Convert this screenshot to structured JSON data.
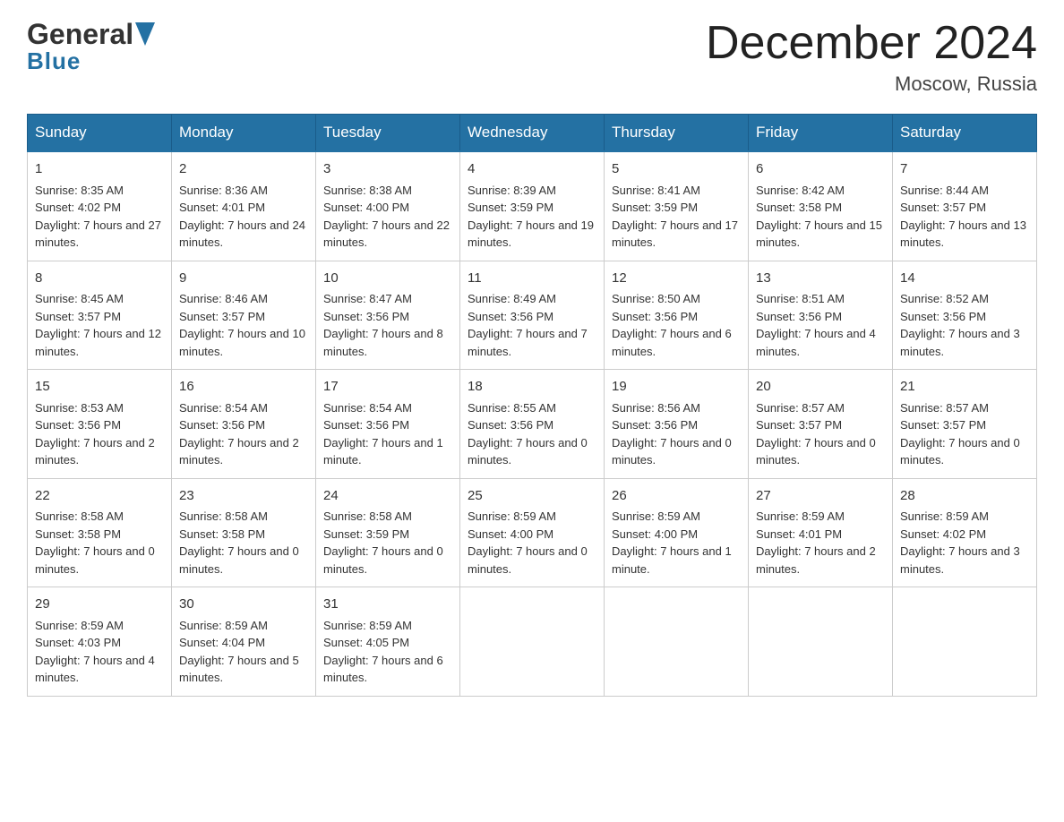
{
  "header": {
    "logo_general": "General",
    "logo_blue": "Blue",
    "month_year": "December 2024",
    "location": "Moscow, Russia"
  },
  "days_of_week": [
    "Sunday",
    "Monday",
    "Tuesday",
    "Wednesday",
    "Thursday",
    "Friday",
    "Saturday"
  ],
  "weeks": [
    [
      {
        "day": "1",
        "sunrise": "Sunrise: 8:35 AM",
        "sunset": "Sunset: 4:02 PM",
        "daylight": "Daylight: 7 hours and 27 minutes."
      },
      {
        "day": "2",
        "sunrise": "Sunrise: 8:36 AM",
        "sunset": "Sunset: 4:01 PM",
        "daylight": "Daylight: 7 hours and 24 minutes."
      },
      {
        "day": "3",
        "sunrise": "Sunrise: 8:38 AM",
        "sunset": "Sunset: 4:00 PM",
        "daylight": "Daylight: 7 hours and 22 minutes."
      },
      {
        "day": "4",
        "sunrise": "Sunrise: 8:39 AM",
        "sunset": "Sunset: 3:59 PM",
        "daylight": "Daylight: 7 hours and 19 minutes."
      },
      {
        "day": "5",
        "sunrise": "Sunrise: 8:41 AM",
        "sunset": "Sunset: 3:59 PM",
        "daylight": "Daylight: 7 hours and 17 minutes."
      },
      {
        "day": "6",
        "sunrise": "Sunrise: 8:42 AM",
        "sunset": "Sunset: 3:58 PM",
        "daylight": "Daylight: 7 hours and 15 minutes."
      },
      {
        "day": "7",
        "sunrise": "Sunrise: 8:44 AM",
        "sunset": "Sunset: 3:57 PM",
        "daylight": "Daylight: 7 hours and 13 minutes."
      }
    ],
    [
      {
        "day": "8",
        "sunrise": "Sunrise: 8:45 AM",
        "sunset": "Sunset: 3:57 PM",
        "daylight": "Daylight: 7 hours and 12 minutes."
      },
      {
        "day": "9",
        "sunrise": "Sunrise: 8:46 AM",
        "sunset": "Sunset: 3:57 PM",
        "daylight": "Daylight: 7 hours and 10 minutes."
      },
      {
        "day": "10",
        "sunrise": "Sunrise: 8:47 AM",
        "sunset": "Sunset: 3:56 PM",
        "daylight": "Daylight: 7 hours and 8 minutes."
      },
      {
        "day": "11",
        "sunrise": "Sunrise: 8:49 AM",
        "sunset": "Sunset: 3:56 PM",
        "daylight": "Daylight: 7 hours and 7 minutes."
      },
      {
        "day": "12",
        "sunrise": "Sunrise: 8:50 AM",
        "sunset": "Sunset: 3:56 PM",
        "daylight": "Daylight: 7 hours and 6 minutes."
      },
      {
        "day": "13",
        "sunrise": "Sunrise: 8:51 AM",
        "sunset": "Sunset: 3:56 PM",
        "daylight": "Daylight: 7 hours and 4 minutes."
      },
      {
        "day": "14",
        "sunrise": "Sunrise: 8:52 AM",
        "sunset": "Sunset: 3:56 PM",
        "daylight": "Daylight: 7 hours and 3 minutes."
      }
    ],
    [
      {
        "day": "15",
        "sunrise": "Sunrise: 8:53 AM",
        "sunset": "Sunset: 3:56 PM",
        "daylight": "Daylight: 7 hours and 2 minutes."
      },
      {
        "day": "16",
        "sunrise": "Sunrise: 8:54 AM",
        "sunset": "Sunset: 3:56 PM",
        "daylight": "Daylight: 7 hours and 2 minutes."
      },
      {
        "day": "17",
        "sunrise": "Sunrise: 8:54 AM",
        "sunset": "Sunset: 3:56 PM",
        "daylight": "Daylight: 7 hours and 1 minute."
      },
      {
        "day": "18",
        "sunrise": "Sunrise: 8:55 AM",
        "sunset": "Sunset: 3:56 PM",
        "daylight": "Daylight: 7 hours and 0 minutes."
      },
      {
        "day": "19",
        "sunrise": "Sunrise: 8:56 AM",
        "sunset": "Sunset: 3:56 PM",
        "daylight": "Daylight: 7 hours and 0 minutes."
      },
      {
        "day": "20",
        "sunrise": "Sunrise: 8:57 AM",
        "sunset": "Sunset: 3:57 PM",
        "daylight": "Daylight: 7 hours and 0 minutes."
      },
      {
        "day": "21",
        "sunrise": "Sunrise: 8:57 AM",
        "sunset": "Sunset: 3:57 PM",
        "daylight": "Daylight: 7 hours and 0 minutes."
      }
    ],
    [
      {
        "day": "22",
        "sunrise": "Sunrise: 8:58 AM",
        "sunset": "Sunset: 3:58 PM",
        "daylight": "Daylight: 7 hours and 0 minutes."
      },
      {
        "day": "23",
        "sunrise": "Sunrise: 8:58 AM",
        "sunset": "Sunset: 3:58 PM",
        "daylight": "Daylight: 7 hours and 0 minutes."
      },
      {
        "day": "24",
        "sunrise": "Sunrise: 8:58 AM",
        "sunset": "Sunset: 3:59 PM",
        "daylight": "Daylight: 7 hours and 0 minutes."
      },
      {
        "day": "25",
        "sunrise": "Sunrise: 8:59 AM",
        "sunset": "Sunset: 4:00 PM",
        "daylight": "Daylight: 7 hours and 0 minutes."
      },
      {
        "day": "26",
        "sunrise": "Sunrise: 8:59 AM",
        "sunset": "Sunset: 4:00 PM",
        "daylight": "Daylight: 7 hours and 1 minute."
      },
      {
        "day": "27",
        "sunrise": "Sunrise: 8:59 AM",
        "sunset": "Sunset: 4:01 PM",
        "daylight": "Daylight: 7 hours and 2 minutes."
      },
      {
        "day": "28",
        "sunrise": "Sunrise: 8:59 AM",
        "sunset": "Sunset: 4:02 PM",
        "daylight": "Daylight: 7 hours and 3 minutes."
      }
    ],
    [
      {
        "day": "29",
        "sunrise": "Sunrise: 8:59 AM",
        "sunset": "Sunset: 4:03 PM",
        "daylight": "Daylight: 7 hours and 4 minutes."
      },
      {
        "day": "30",
        "sunrise": "Sunrise: 8:59 AM",
        "sunset": "Sunset: 4:04 PM",
        "daylight": "Daylight: 7 hours and 5 minutes."
      },
      {
        "day": "31",
        "sunrise": "Sunrise: 8:59 AM",
        "sunset": "Sunset: 4:05 PM",
        "daylight": "Daylight: 7 hours and 6 minutes."
      },
      null,
      null,
      null,
      null
    ]
  ]
}
